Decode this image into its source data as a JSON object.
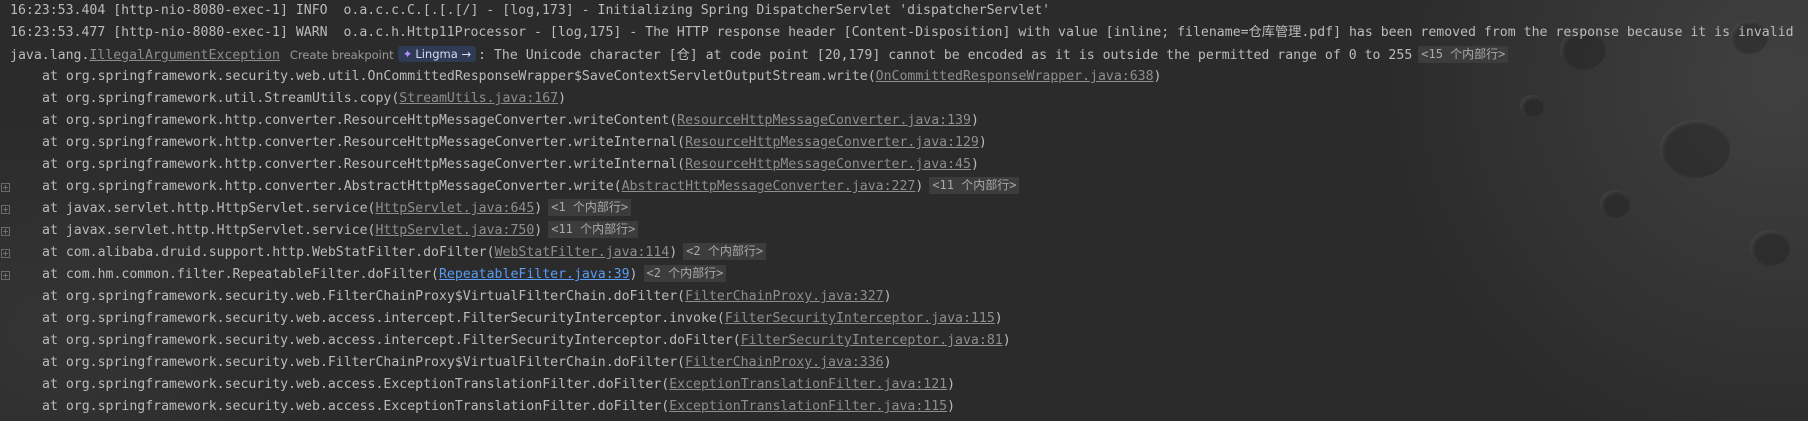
{
  "log": [
    "16:23:53.404 [http-nio-8080-exec-1] INFO  o.a.c.c.C.[.[.[/] - [log,173] - Initializing Spring DispatcherServlet 'dispatcherServlet'",
    "16:23:53.477 [http-nio-8080-exec-1] WARN  o.a.c.h.Http11Processor - [log,175] - The HTTP response header [Content-Disposition] with value [inline; filename=仓库管理.pdf] has been removed from the response because it is invalid"
  ],
  "exception": {
    "prefix": "java.lang.",
    "class_link": "IllegalArgumentException",
    "create_breakpoint": "Create breakpoint",
    "lingma_label": "Lingma",
    "lingma_arrow": "→",
    "message": ": The Unicode character [仓] at code point [20,179] cannot be encoded as it is outside the permitted range of 0 to 255",
    "internal": "<15 个内部行>"
  },
  "frames": [
    {
      "fold": false,
      "text": "at org.springframework.security.web.util.OnCommittedResponseWrapper$SaveContextServletOutputStream.write(",
      "link": "OnCommittedResponseWrapper.java:638",
      "suffix": ")",
      "internal": "",
      "active": false
    },
    {
      "fold": false,
      "text": "at org.springframework.util.StreamUtils.copy(",
      "link": "StreamUtils.java:167",
      "suffix": ")",
      "internal": "",
      "active": false
    },
    {
      "fold": false,
      "text": "at org.springframework.http.converter.ResourceHttpMessageConverter.writeContent(",
      "link": "ResourceHttpMessageConverter.java:139",
      "suffix": ")",
      "internal": "",
      "active": false
    },
    {
      "fold": false,
      "text": "at org.springframework.http.converter.ResourceHttpMessageConverter.writeInternal(",
      "link": "ResourceHttpMessageConverter.java:129",
      "suffix": ")",
      "internal": "",
      "active": false
    },
    {
      "fold": false,
      "text": "at org.springframework.http.converter.ResourceHttpMessageConverter.writeInternal(",
      "link": "ResourceHttpMessageConverter.java:45",
      "suffix": ")",
      "internal": "",
      "active": false
    },
    {
      "fold": true,
      "text": "at org.springframework.http.converter.AbstractHttpMessageConverter.write(",
      "link": "AbstractHttpMessageConverter.java:227",
      "suffix": ")",
      "internal": "<11 个内部行>",
      "active": false
    },
    {
      "fold": true,
      "text": "at javax.servlet.http.HttpServlet.service(",
      "link": "HttpServlet.java:645",
      "suffix": ")",
      "internal": "<1 个内部行>",
      "active": false
    },
    {
      "fold": true,
      "text": "at javax.servlet.http.HttpServlet.service(",
      "link": "HttpServlet.java:750",
      "suffix": ")",
      "internal": "<11 个内部行>",
      "active": false
    },
    {
      "fold": true,
      "text": "at com.alibaba.druid.support.http.WebStatFilter.doFilter(",
      "link": "WebStatFilter.java:114",
      "suffix": ")",
      "internal": "<2 个内部行>",
      "active": false
    },
    {
      "fold": true,
      "text": "at com.hm.common.filter.RepeatableFilter.doFilter(",
      "link": "RepeatableFilter.java:39",
      "suffix": ")",
      "internal": "<2 个内部行>",
      "active": true
    },
    {
      "fold": false,
      "text": "at org.springframework.security.web.FilterChainProxy$VirtualFilterChain.doFilter(",
      "link": "FilterChainProxy.java:327",
      "suffix": ")",
      "internal": "",
      "active": false
    },
    {
      "fold": false,
      "text": "at org.springframework.security.web.access.intercept.FilterSecurityInterceptor.invoke(",
      "link": "FilterSecurityInterceptor.java:115",
      "suffix": ")",
      "internal": "",
      "active": false
    },
    {
      "fold": false,
      "text": "at org.springframework.security.web.access.intercept.FilterSecurityInterceptor.doFilter(",
      "link": "FilterSecurityInterceptor.java:81",
      "suffix": ")",
      "internal": "",
      "active": false
    },
    {
      "fold": false,
      "text": "at org.springframework.security.web.FilterChainProxy$VirtualFilterChain.doFilter(",
      "link": "FilterChainProxy.java:336",
      "suffix": ")",
      "internal": "",
      "active": false
    },
    {
      "fold": false,
      "text": "at org.springframework.security.web.access.ExceptionTranslationFilter.doFilter(",
      "link": "ExceptionTranslationFilter.java:121",
      "suffix": ")",
      "internal": "",
      "active": false
    },
    {
      "fold": false,
      "text": "at org.springframework.security.web.access.ExceptionTranslationFilter.doFilter(",
      "link": "ExceptionTranslationFilter.java:115",
      "suffix": ")",
      "internal": "",
      "active": false
    }
  ]
}
